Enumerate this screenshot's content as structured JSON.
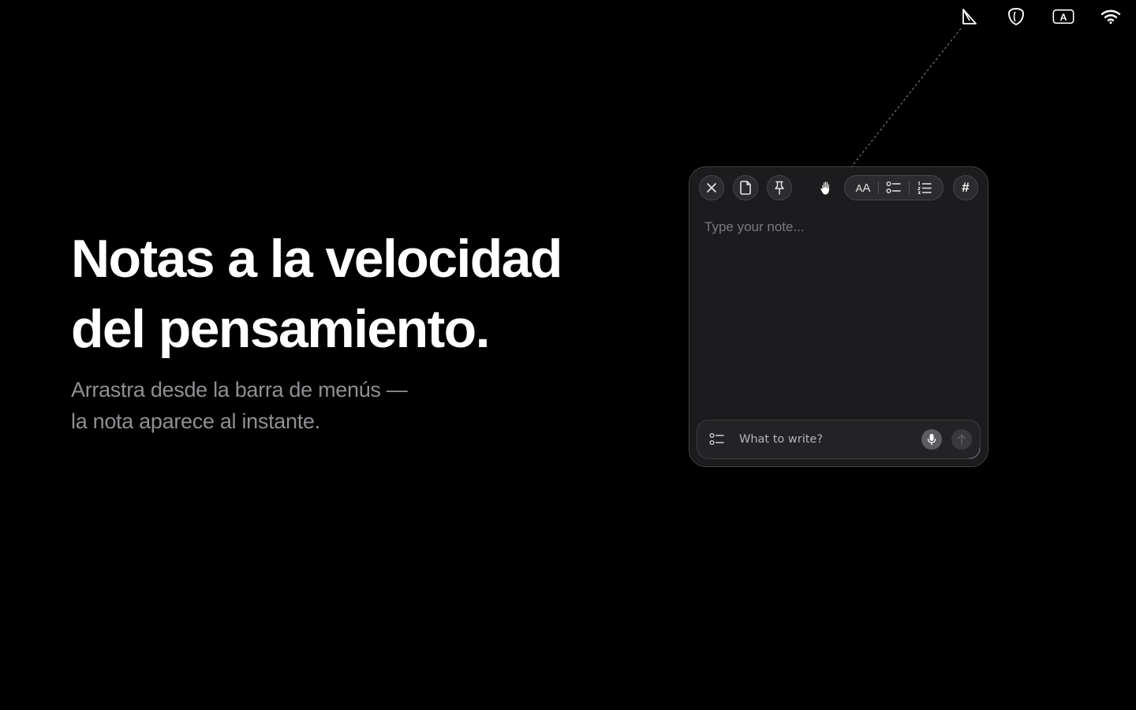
{
  "menubar": {
    "icons": [
      "note-app-icon",
      "shield-icon",
      "input-source-icon",
      "wifi-icon"
    ],
    "input_source_letter": "A"
  },
  "hero": {
    "title_line1": "Notas a la velocidad",
    "title_line2": "del pensamiento.",
    "subtitle_line1": "Arrastra desde la barra de menús —",
    "subtitle_line2": "la nota aparece al instante."
  },
  "note_window": {
    "toolbar": {
      "close_icon": "close-icon",
      "new_note_icon": "document-icon",
      "pin_icon": "pin-icon",
      "drag_icon": "hand-icon",
      "text_size_label_small": "A",
      "text_size_label_big": "A",
      "checklist_icon": "checklist-icon",
      "numbered_list_icon": "numbered-list-icon",
      "tag_label": "#"
    },
    "editor_placeholder": "Type your note...",
    "compose": {
      "placeholder": "What to write?",
      "left_icon": "checklist-icon",
      "mic_icon": "microphone-icon",
      "send_icon": "arrow-up-icon"
    }
  },
  "colors": {
    "background": "#000000",
    "title": "#ffffff",
    "subtitle": "#8f8f94",
    "window_bg": "#1c1c1e",
    "window_border": "#4a4a4e",
    "placeholder": "#7a7a7f"
  }
}
